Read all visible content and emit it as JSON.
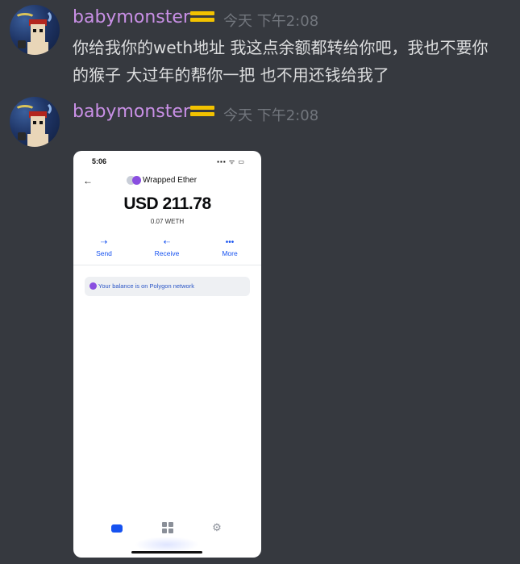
{
  "messages": [
    {
      "username": "babymonster",
      "timestamp": "今天 下午2:08",
      "text_line1": "你给我你的weth地址 我这点余额都转给你吧，我也不要你",
      "text_line2": "的猴子  大过年的帮你一把 也不用还钱给我了"
    },
    {
      "username": "babymonster",
      "timestamp": "今天 下午2:08"
    }
  ],
  "colors": {
    "background": "#36393f",
    "username": "#c990e6",
    "accent_blue": "#1652f0"
  },
  "phone": {
    "status_time": "5:06",
    "status_icons": "▪▪▪ ᯤ ▭",
    "back_icon": "arrow-left-icon",
    "token_name": "Wrapped Ether",
    "balance_usd": "USD 211.78",
    "balance_weth": "0.07 WETH",
    "actions": [
      {
        "label": "Send",
        "icon": "send-icon",
        "glyph": "⇢"
      },
      {
        "label": "Receive",
        "icon": "receive-icon",
        "glyph": "⇠"
      },
      {
        "label": "More",
        "icon": "more-icon",
        "glyph": "•••"
      }
    ],
    "banner": "Your balance is on Polygon network",
    "tabs": [
      "wallet-icon",
      "apps-icon",
      "settings-icon"
    ],
    "settings_glyph": "⚙"
  }
}
